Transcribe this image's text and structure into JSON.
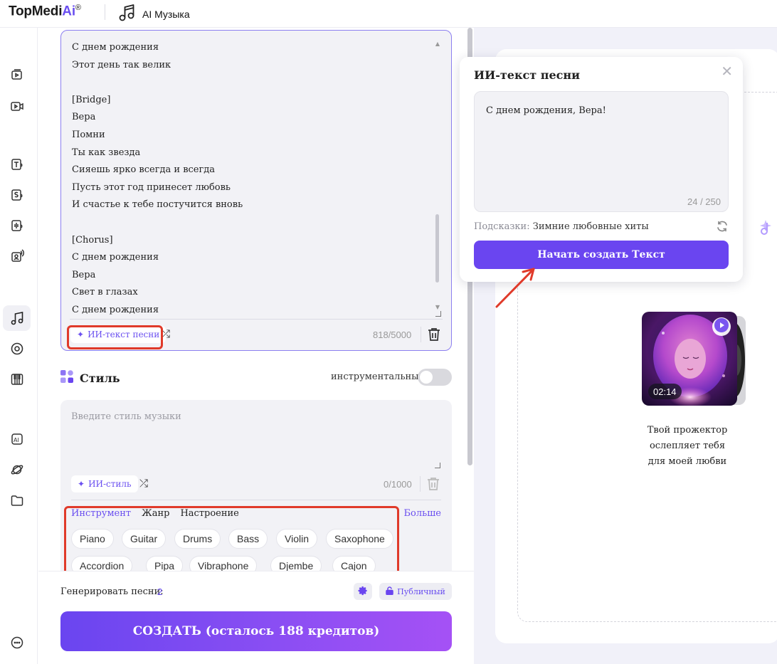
{
  "header": {
    "logo_main": "TopMedi",
    "logo_ai": "Ai",
    "logo_reg": "®",
    "section_title": "AI Музыка"
  },
  "sidebar": {
    "items": [
      {
        "icon": "video-edit-icon"
      },
      {
        "icon": "video-play-icon"
      },
      {
        "icon": "text-to-speech-icon"
      },
      {
        "icon": "speech-icon"
      },
      {
        "icon": "voice-wave-icon"
      },
      {
        "icon": "voice-changer-icon"
      },
      {
        "icon": "music-note-icon",
        "active": true
      },
      {
        "icon": "vinyl-icon"
      },
      {
        "icon": "piano-icon"
      },
      {
        "icon": "ai-badge-icon"
      },
      {
        "icon": "planet-icon"
      },
      {
        "icon": "folder-icon"
      },
      {
        "icon": "chat-bubble-icon"
      }
    ]
  },
  "lyrics": {
    "text": "С днем рождения\nЭтот день так велик\n\n[Bridge]\nВера\nПомни\nТы как звезда\nСияешь ярко всегда и всегда\nПусть этот год принесет любовь\nИ счастье к тебе постучится вновь\n\n[Chorus]\nС днем рождения\nВера\nСвет в глазах\nС днем рождения",
    "ai_button": "ИИ-текст песни",
    "counter": "818/5000"
  },
  "style": {
    "title": "Стиль",
    "instrumental_label": "инструментальный",
    "instrumental_on": false,
    "placeholder": "Введите стиль музыки",
    "ai_button": "ИИ-стиль",
    "counter": "0/1000",
    "tabs": [
      "Инструмент",
      "Жанр",
      "Настроение"
    ],
    "active_tab": "Инструмент",
    "more_label": "Больше",
    "chips_row1": [
      "Piano",
      "Guitar",
      "Drums",
      "Bass",
      "Violin",
      "Saxophone"
    ],
    "chips_row2": [
      "Accordion",
      "Pipa",
      "Vibraphone",
      "Djembe",
      "Cajon"
    ]
  },
  "generate": {
    "label": "Генерировать песни:",
    "count": "2",
    "public_label": "Публичный",
    "create_button": "СОЗДАТЬ (осталось 188 кредитов)"
  },
  "popup": {
    "title": "ИИ-текст песни",
    "input_value": "С днем рождения, Вера!",
    "counter": "24 / 250",
    "hint_label": "Подсказки:",
    "hint_value": "Зимние любовные хиты",
    "button": "Начать создать Текст"
  },
  "preview": {
    "duration": "02:14",
    "description": "Твой прожектор ослепляет тебя для моей любви"
  },
  "colors": {
    "accent": "#6a45f0",
    "highlight": "#e03a2a",
    "panel_bg": "#f2f2f6",
    "right_bg": "#f1f1f9"
  }
}
